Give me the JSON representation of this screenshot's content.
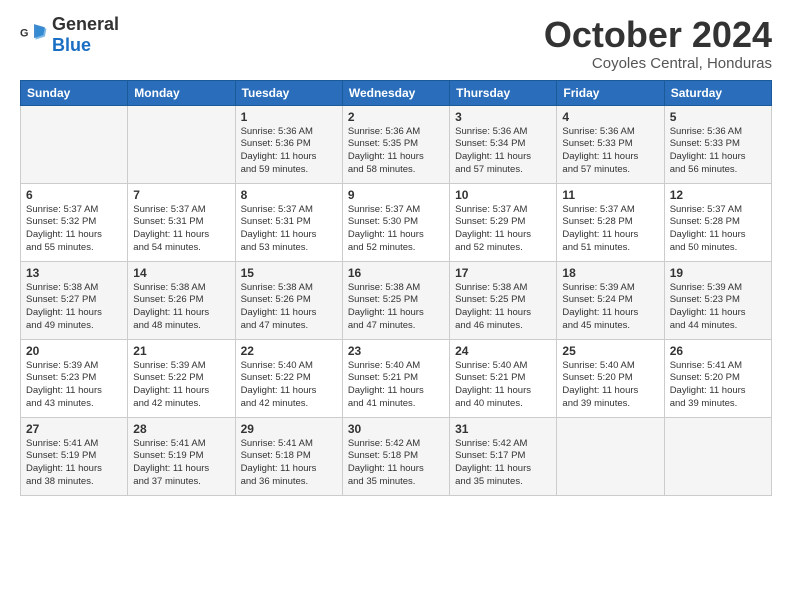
{
  "header": {
    "logo_general": "General",
    "logo_blue": "Blue",
    "month_year": "October 2024",
    "location": "Coyoles Central, Honduras"
  },
  "columns": [
    "Sunday",
    "Monday",
    "Tuesday",
    "Wednesday",
    "Thursday",
    "Friday",
    "Saturday"
  ],
  "weeks": [
    {
      "days": [
        {
          "num": "",
          "info": ""
        },
        {
          "num": "",
          "info": ""
        },
        {
          "num": "1",
          "info": "Sunrise: 5:36 AM\nSunset: 5:36 PM\nDaylight: 11 hours\nand 59 minutes."
        },
        {
          "num": "2",
          "info": "Sunrise: 5:36 AM\nSunset: 5:35 PM\nDaylight: 11 hours\nand 58 minutes."
        },
        {
          "num": "3",
          "info": "Sunrise: 5:36 AM\nSunset: 5:34 PM\nDaylight: 11 hours\nand 57 minutes."
        },
        {
          "num": "4",
          "info": "Sunrise: 5:36 AM\nSunset: 5:33 PM\nDaylight: 11 hours\nand 57 minutes."
        },
        {
          "num": "5",
          "info": "Sunrise: 5:36 AM\nSunset: 5:33 PM\nDaylight: 11 hours\nand 56 minutes."
        }
      ]
    },
    {
      "days": [
        {
          "num": "6",
          "info": "Sunrise: 5:37 AM\nSunset: 5:32 PM\nDaylight: 11 hours\nand 55 minutes."
        },
        {
          "num": "7",
          "info": "Sunrise: 5:37 AM\nSunset: 5:31 PM\nDaylight: 11 hours\nand 54 minutes."
        },
        {
          "num": "8",
          "info": "Sunrise: 5:37 AM\nSunset: 5:31 PM\nDaylight: 11 hours\nand 53 minutes."
        },
        {
          "num": "9",
          "info": "Sunrise: 5:37 AM\nSunset: 5:30 PM\nDaylight: 11 hours\nand 52 minutes."
        },
        {
          "num": "10",
          "info": "Sunrise: 5:37 AM\nSunset: 5:29 PM\nDaylight: 11 hours\nand 52 minutes."
        },
        {
          "num": "11",
          "info": "Sunrise: 5:37 AM\nSunset: 5:28 PM\nDaylight: 11 hours\nand 51 minutes."
        },
        {
          "num": "12",
          "info": "Sunrise: 5:37 AM\nSunset: 5:28 PM\nDaylight: 11 hours\nand 50 minutes."
        }
      ]
    },
    {
      "days": [
        {
          "num": "13",
          "info": "Sunrise: 5:38 AM\nSunset: 5:27 PM\nDaylight: 11 hours\nand 49 minutes."
        },
        {
          "num": "14",
          "info": "Sunrise: 5:38 AM\nSunset: 5:26 PM\nDaylight: 11 hours\nand 48 minutes."
        },
        {
          "num": "15",
          "info": "Sunrise: 5:38 AM\nSunset: 5:26 PM\nDaylight: 11 hours\nand 47 minutes."
        },
        {
          "num": "16",
          "info": "Sunrise: 5:38 AM\nSunset: 5:25 PM\nDaylight: 11 hours\nand 47 minutes."
        },
        {
          "num": "17",
          "info": "Sunrise: 5:38 AM\nSunset: 5:25 PM\nDaylight: 11 hours\nand 46 minutes."
        },
        {
          "num": "18",
          "info": "Sunrise: 5:39 AM\nSunset: 5:24 PM\nDaylight: 11 hours\nand 45 minutes."
        },
        {
          "num": "19",
          "info": "Sunrise: 5:39 AM\nSunset: 5:23 PM\nDaylight: 11 hours\nand 44 minutes."
        }
      ]
    },
    {
      "days": [
        {
          "num": "20",
          "info": "Sunrise: 5:39 AM\nSunset: 5:23 PM\nDaylight: 11 hours\nand 43 minutes."
        },
        {
          "num": "21",
          "info": "Sunrise: 5:39 AM\nSunset: 5:22 PM\nDaylight: 11 hours\nand 42 minutes."
        },
        {
          "num": "22",
          "info": "Sunrise: 5:40 AM\nSunset: 5:22 PM\nDaylight: 11 hours\nand 42 minutes."
        },
        {
          "num": "23",
          "info": "Sunrise: 5:40 AM\nSunset: 5:21 PM\nDaylight: 11 hours\nand 41 minutes."
        },
        {
          "num": "24",
          "info": "Sunrise: 5:40 AM\nSunset: 5:21 PM\nDaylight: 11 hours\nand 40 minutes."
        },
        {
          "num": "25",
          "info": "Sunrise: 5:40 AM\nSunset: 5:20 PM\nDaylight: 11 hours\nand 39 minutes."
        },
        {
          "num": "26",
          "info": "Sunrise: 5:41 AM\nSunset: 5:20 PM\nDaylight: 11 hours\nand 39 minutes."
        }
      ]
    },
    {
      "days": [
        {
          "num": "27",
          "info": "Sunrise: 5:41 AM\nSunset: 5:19 PM\nDaylight: 11 hours\nand 38 minutes."
        },
        {
          "num": "28",
          "info": "Sunrise: 5:41 AM\nSunset: 5:19 PM\nDaylight: 11 hours\nand 37 minutes."
        },
        {
          "num": "29",
          "info": "Sunrise: 5:41 AM\nSunset: 5:18 PM\nDaylight: 11 hours\nand 36 minutes."
        },
        {
          "num": "30",
          "info": "Sunrise: 5:42 AM\nSunset: 5:18 PM\nDaylight: 11 hours\nand 35 minutes."
        },
        {
          "num": "31",
          "info": "Sunrise: 5:42 AM\nSunset: 5:17 PM\nDaylight: 11 hours\nand 35 minutes."
        },
        {
          "num": "",
          "info": ""
        },
        {
          "num": "",
          "info": ""
        }
      ]
    }
  ]
}
